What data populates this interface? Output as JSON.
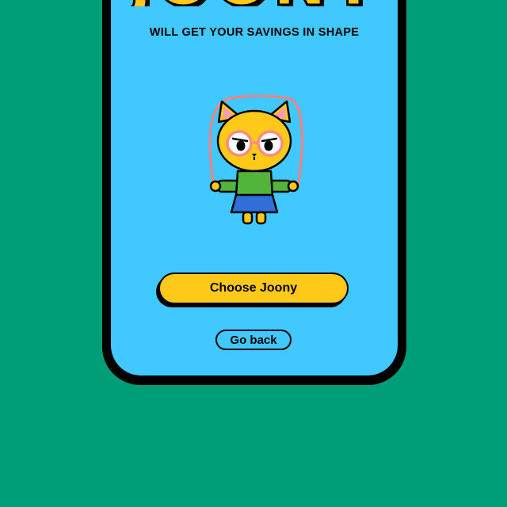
{
  "app": {
    "logo_text": "JOONY",
    "tagline": "WILL GET YOUR SAVINGS IN SHAPE"
  },
  "mascot": {
    "icon": "cat-jump-rope-icon",
    "colors": {
      "body": "#ffc91a",
      "shirt": "#52b43a",
      "skirt": "#2f6fd6",
      "glasses": "#ff8a80",
      "rope": "#ff7f7f"
    }
  },
  "actions": {
    "primary_label": "Choose Joony",
    "secondary_label": "Go back"
  },
  "colors": {
    "background": "#009e78",
    "screen": "#41c8ff",
    "accent": "#ffc91a"
  }
}
